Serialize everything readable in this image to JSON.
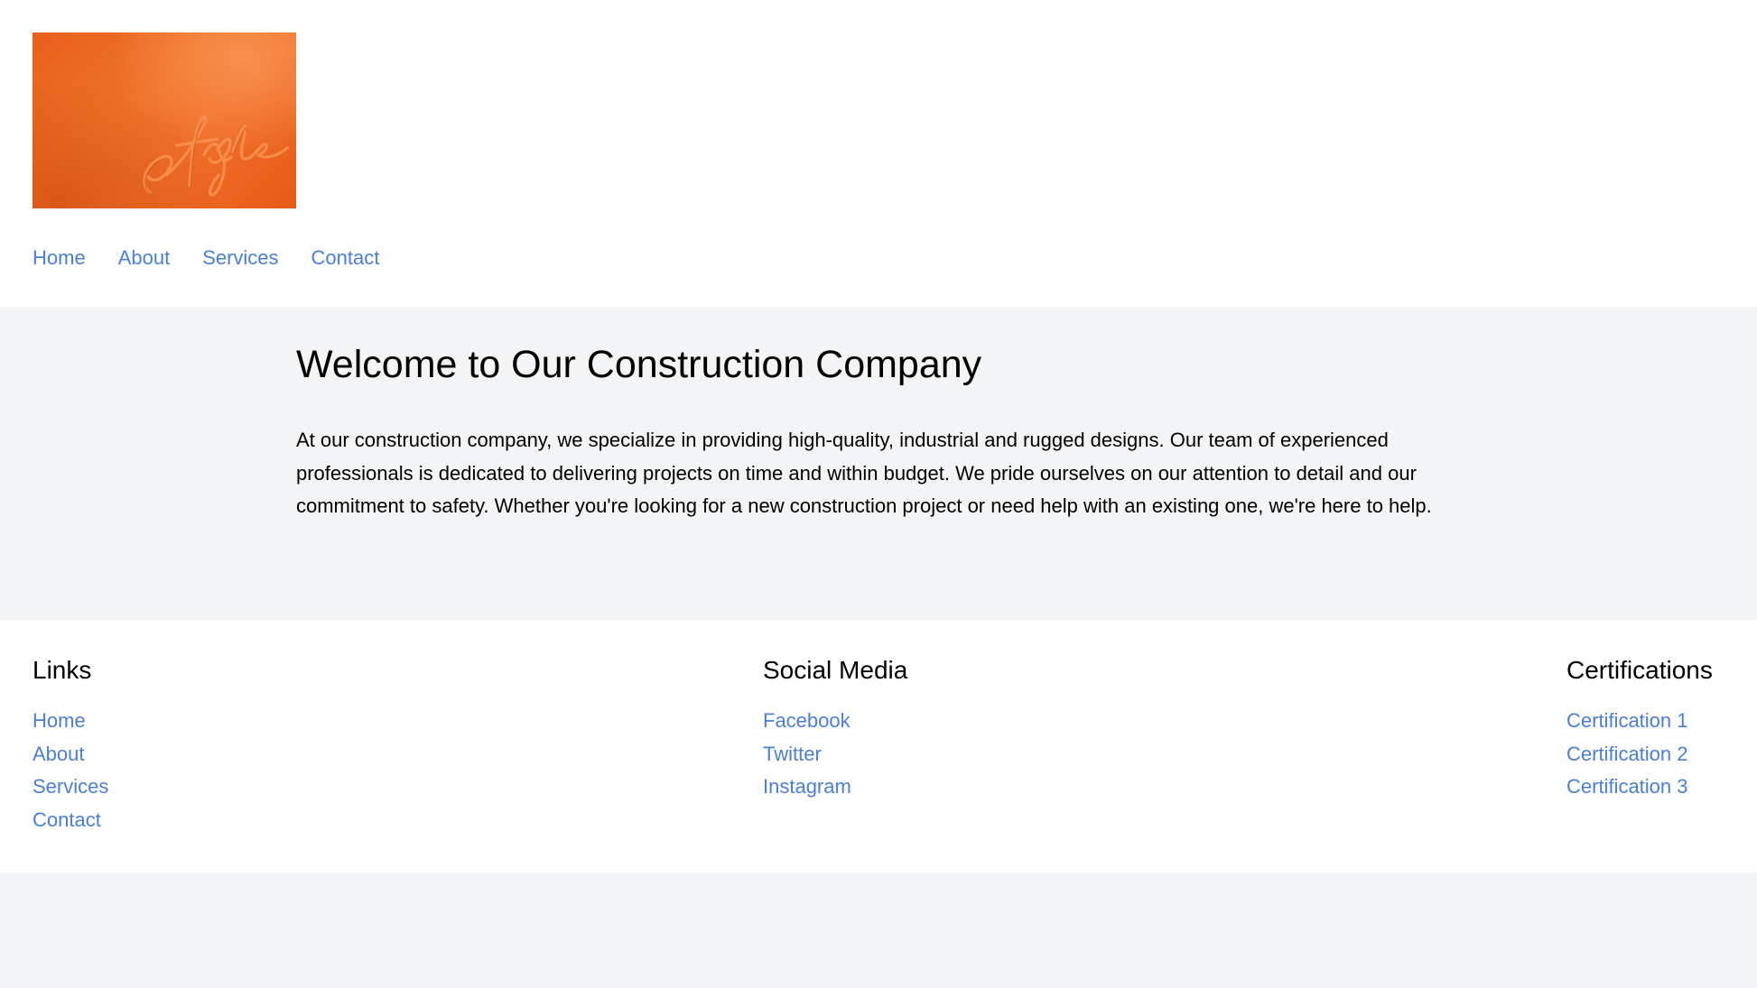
{
  "header": {
    "logo_alt": "Style logo",
    "logo_text": "Style",
    "nav": [
      {
        "label": "Home"
      },
      {
        "label": "About"
      },
      {
        "label": "Services"
      },
      {
        "label": "Contact"
      }
    ]
  },
  "main": {
    "title": "Welcome to Our Construction Company",
    "body": "At our construction company, we specialize in providing high-quality, industrial and rugged designs. Our team of experienced professionals is dedicated to delivering projects on time and within budget. We pride ourselves on our attention to detail and our commitment to safety. Whether you're looking for a new construction project or need help with an existing one, we're here to help."
  },
  "footer": {
    "links": {
      "title": "Links",
      "items": [
        {
          "label": "Home"
        },
        {
          "label": "About"
        },
        {
          "label": "Services"
        },
        {
          "label": "Contact"
        }
      ]
    },
    "social": {
      "title": "Social Media",
      "items": [
        {
          "label": "Facebook"
        },
        {
          "label": "Twitter"
        },
        {
          "label": "Instagram"
        }
      ]
    },
    "certifications": {
      "title": "Certifications",
      "items": [
        {
          "label": "Certification 1"
        },
        {
          "label": "Certification 2"
        },
        {
          "label": "Certification 3"
        }
      ]
    }
  },
  "colors": {
    "link": "#4a7fd6",
    "page_background": "#f3f4f6",
    "surface": "#ffffff",
    "logo_orange": "#ee7226"
  }
}
